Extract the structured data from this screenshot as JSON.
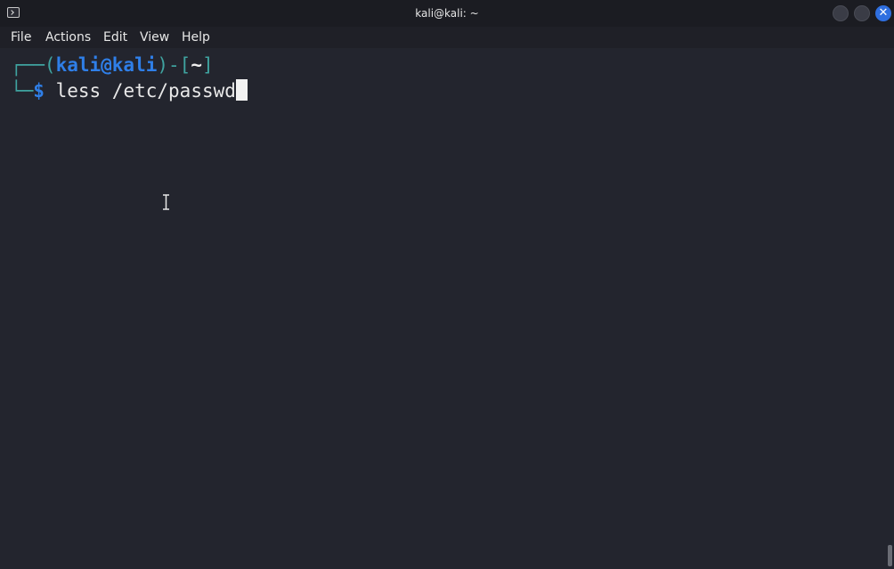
{
  "window": {
    "title": "kali@kali: ~",
    "icon": "terminal-icon",
    "controls": [
      "minimize-icon",
      "maximize-icon",
      "close-icon"
    ],
    "close_glyph": "✕"
  },
  "menu": {
    "items": [
      {
        "label": "File"
      },
      {
        "label": "Actions"
      },
      {
        "label": "Edit"
      },
      {
        "label": "View"
      },
      {
        "label": "Help"
      }
    ]
  },
  "prompt": {
    "corner_top": "┌──(",
    "user_host": "kali@kali",
    "mid": ")-[",
    "cwd": "~",
    "end": "]",
    "corner_bottom": "└─",
    "symbol": "$",
    "command": " less /etc/passwd"
  },
  "colors": {
    "background": "#23252e",
    "prompt_frame": "#3fa3a0",
    "prompt_user": "#2f7fe8",
    "accent_close": "#2f6fe0"
  },
  "cursor": {
    "mouse": "ibeam-cursor-icon"
  }
}
